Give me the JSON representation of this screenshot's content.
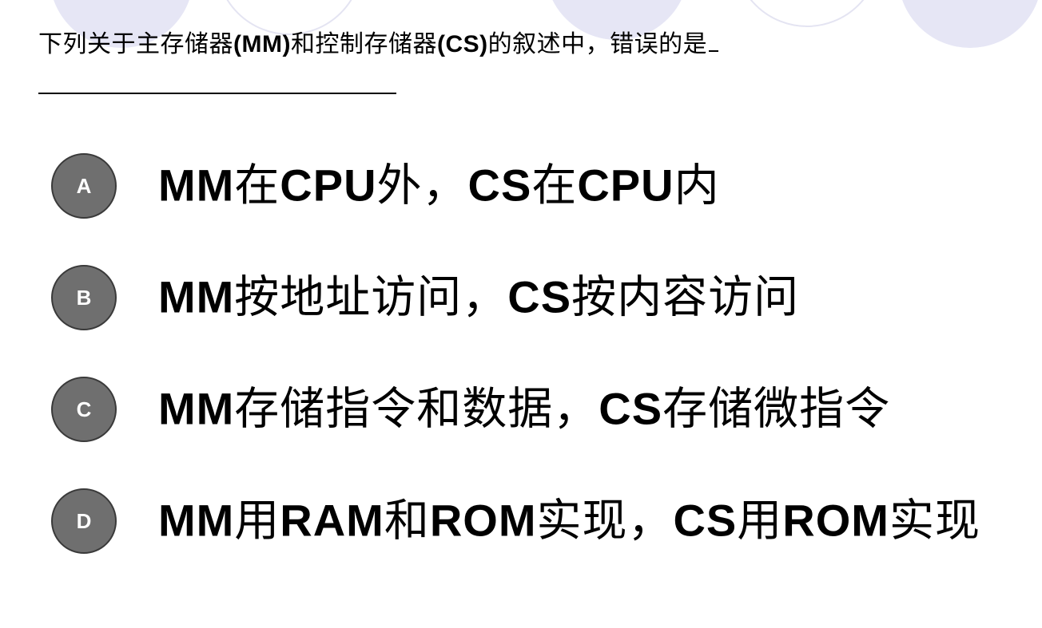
{
  "question": {
    "segments": [
      {
        "text": "下列关于主存储器",
        "latin": false
      },
      {
        "text": "(MM)",
        "latin": true
      },
      {
        "text": "和控制存储器",
        "latin": false
      },
      {
        "text": "(CS)",
        "latin": true
      },
      {
        "text": "的叙述中，错误的是",
        "latin": false
      }
    ]
  },
  "options": [
    {
      "letter": "A",
      "segments": [
        {
          "text": "MM",
          "latin": true
        },
        {
          "text": "在",
          "latin": false
        },
        {
          "text": "CPU",
          "latin": true
        },
        {
          "text": "外，",
          "latin": false
        },
        {
          "text": "CS",
          "latin": true
        },
        {
          "text": "在",
          "latin": false
        },
        {
          "text": "CPU",
          "latin": true
        },
        {
          "text": "内",
          "latin": false
        }
      ]
    },
    {
      "letter": "B",
      "segments": [
        {
          "text": "MM",
          "latin": true
        },
        {
          "text": "按地址访问，",
          "latin": false
        },
        {
          "text": "CS",
          "latin": true
        },
        {
          "text": "按内容访问",
          "latin": false
        }
      ]
    },
    {
      "letter": "C",
      "segments": [
        {
          "text": "MM",
          "latin": true
        },
        {
          "text": "存储指令和数据，",
          "latin": false
        },
        {
          "text": "CS",
          "latin": true
        },
        {
          "text": "存储微指令",
          "latin": false
        }
      ]
    },
    {
      "letter": "D",
      "segments": [
        {
          "text": "MM",
          "latin": true
        },
        {
          "text": "用",
          "latin": false
        },
        {
          "text": "RAM",
          "latin": true
        },
        {
          "text": "和",
          "latin": false
        },
        {
          "text": "ROM",
          "latin": true
        },
        {
          "text": "实现，",
          "latin": false
        },
        {
          "text": "CS",
          "latin": true
        },
        {
          "text": "用",
          "latin": false
        },
        {
          "text": "ROM",
          "latin": true
        },
        {
          "text": "实现",
          "latin": false
        }
      ]
    }
  ],
  "colors": {
    "badge_fill": "#6f6f6f",
    "badge_border": "#3a3a3a",
    "decoration": "#e6e6f5"
  }
}
